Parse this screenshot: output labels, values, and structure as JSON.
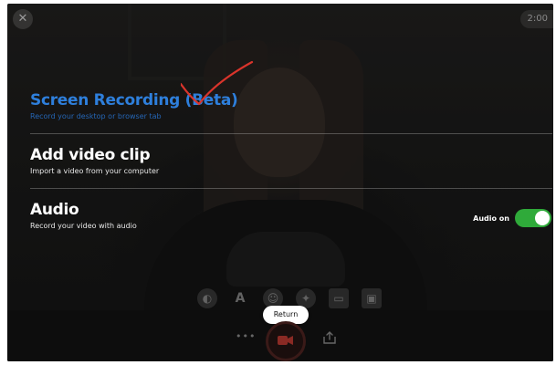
{
  "top": {
    "close_icon": "close-icon",
    "timer": "2:00"
  },
  "menu": {
    "screen_recording": {
      "title": "Screen Recording (Beta)",
      "subtitle": "Record your desktop or browser tab"
    },
    "add_video": {
      "title": "Add video clip",
      "subtitle": "Import a video from your computer"
    },
    "audio": {
      "title": "Audio",
      "subtitle": "Record your video with audio",
      "toggle_label": "Audio on",
      "toggle_on": true
    }
  },
  "bottom": {
    "return_label": "Return",
    "more_glyph": "•••"
  },
  "toolbar_glyphs": {
    "text_tool": "A"
  },
  "colors": {
    "accent_blue": "#2e7fdc",
    "toggle_green": "#2faa3a",
    "annotation_red": "#d9342b"
  }
}
